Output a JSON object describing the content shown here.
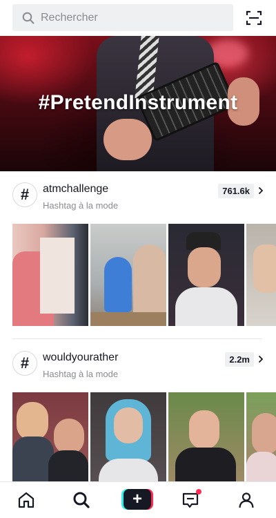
{
  "search": {
    "placeholder": "Rechercher",
    "icon": "search-icon"
  },
  "scan": {
    "icon": "scan-icon"
  },
  "banner": {
    "title": "#PretendInstrument"
  },
  "hashtags": [
    {
      "name": "atmchallenge",
      "subtitle": "Hashtag à la mode",
      "count": "761.6k"
    },
    {
      "name": "wouldyourather",
      "subtitle": "Hashtag à la mode",
      "count": "2.2m"
    }
  ],
  "nav": {
    "items": [
      "home-icon",
      "discover-icon",
      "create-icon",
      "inbox-icon",
      "profile-icon"
    ]
  },
  "colors": {
    "accent": "#fe2c55",
    "cyan": "#25f4ee",
    "text": "#161823",
    "muted": "#8a8b91"
  }
}
